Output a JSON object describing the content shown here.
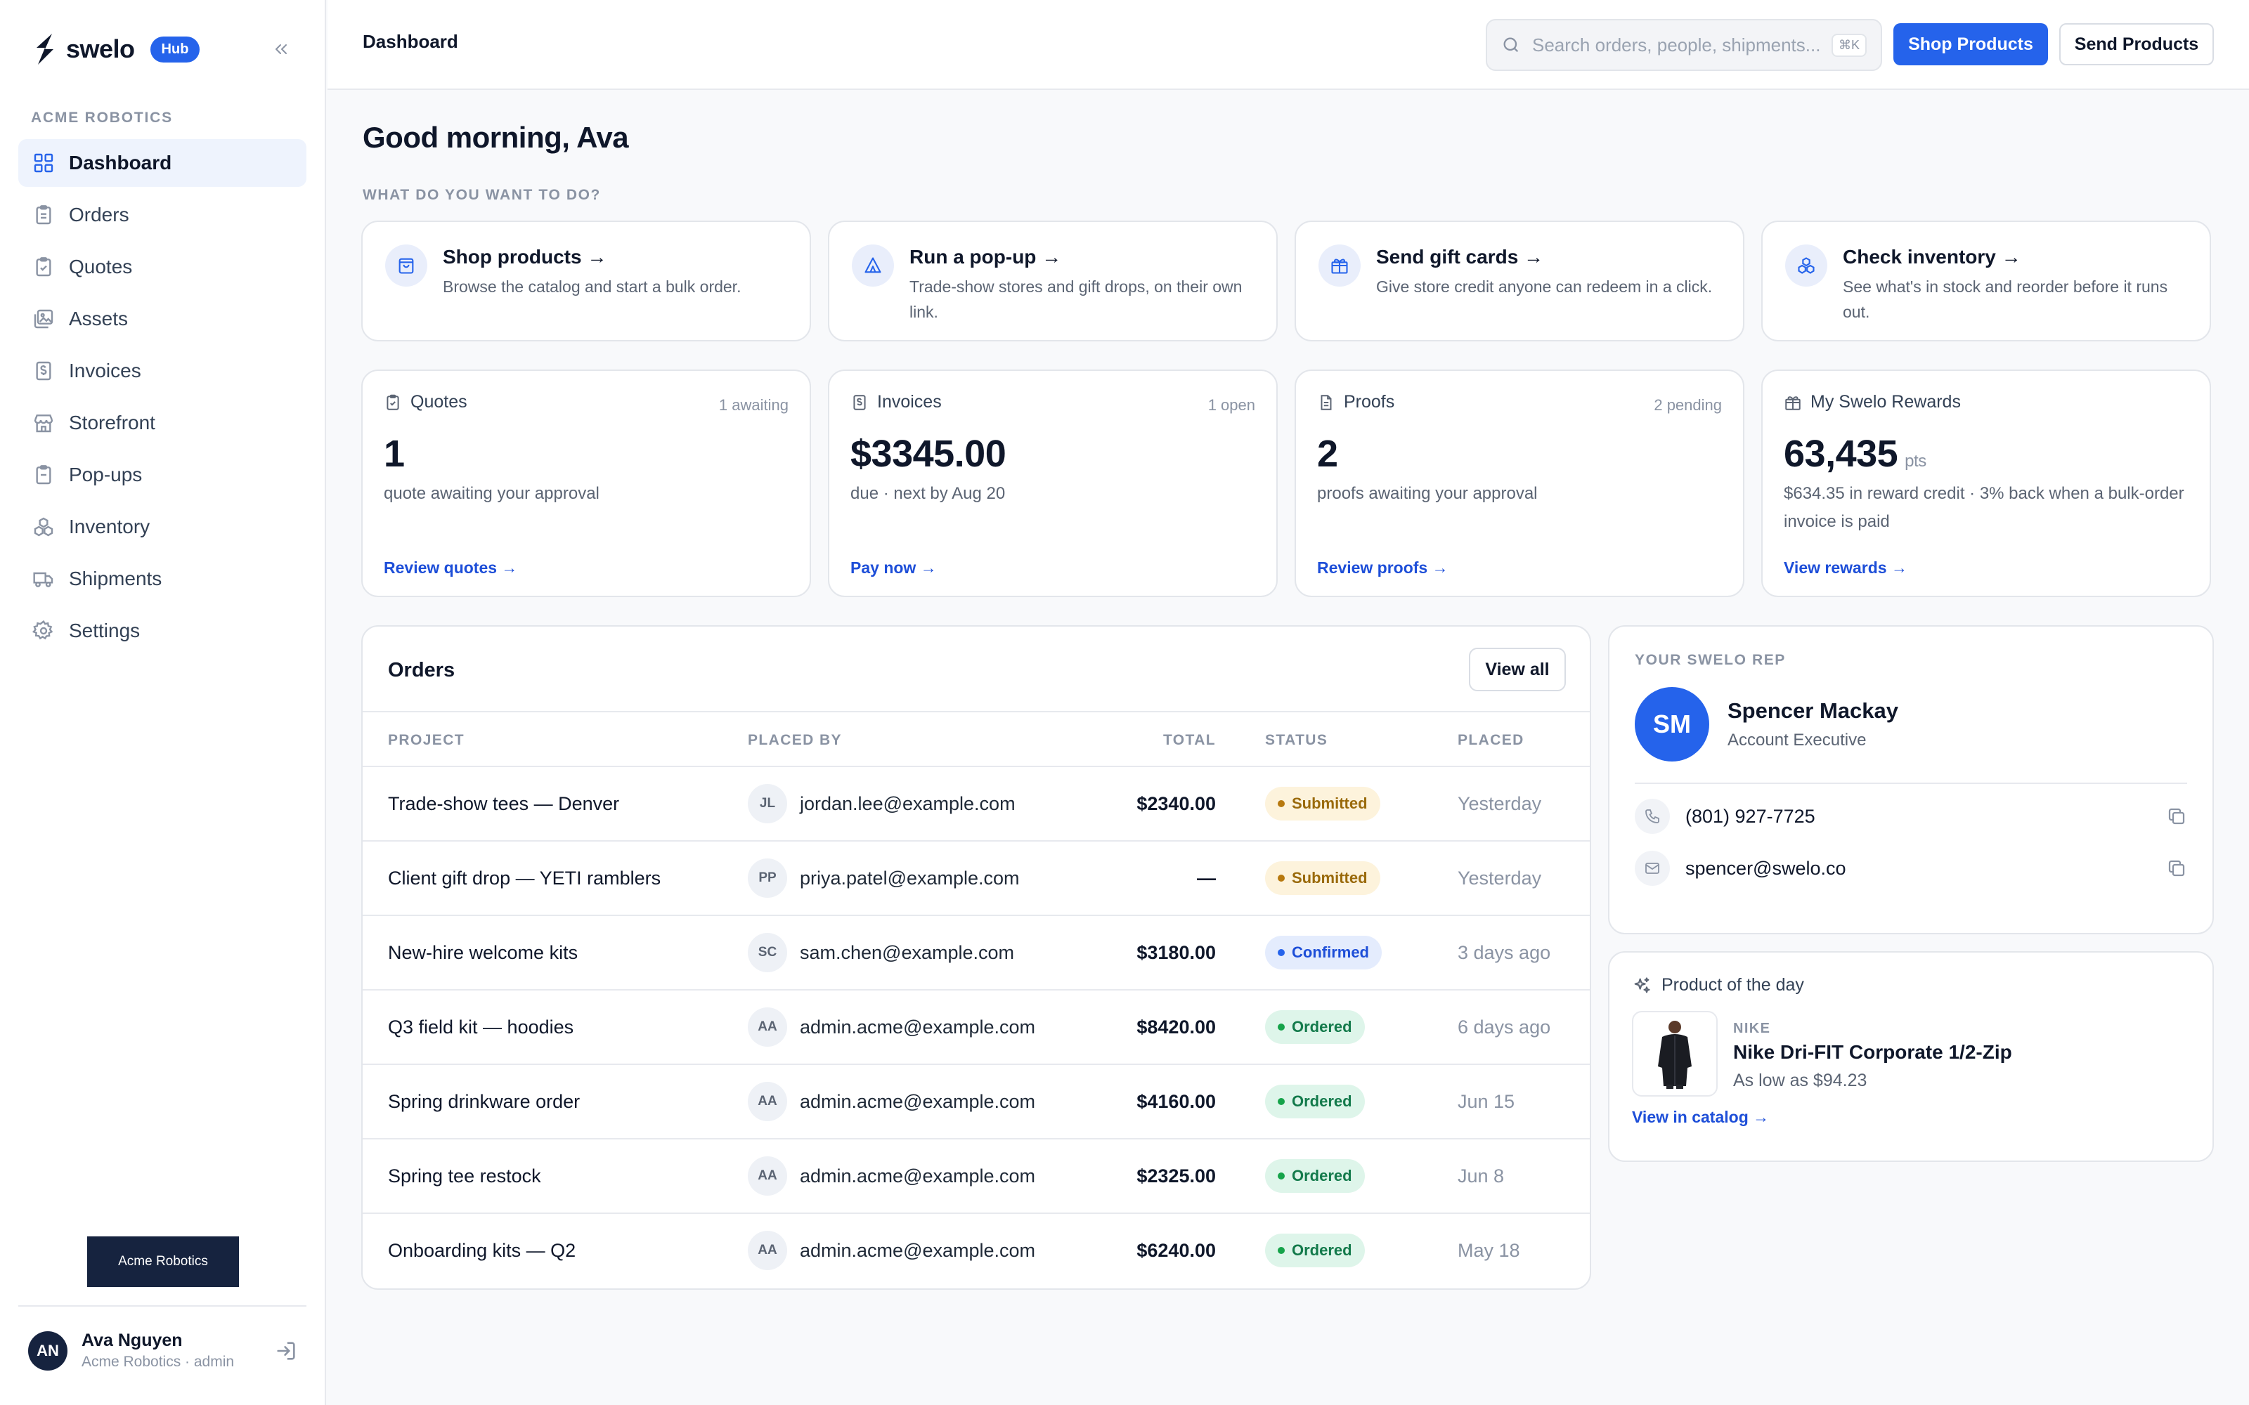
{
  "brand": {
    "name": "swelo",
    "badge": "Hub"
  },
  "sidebar": {
    "org_label": "ACME ROBOTICS",
    "items": [
      {
        "label": "Dashboard",
        "icon": "dashboard-grid-icon",
        "active": true
      },
      {
        "label": "Orders",
        "icon": "clipboard-icon"
      },
      {
        "label": "Quotes",
        "icon": "clipboard-check-icon"
      },
      {
        "label": "Assets",
        "icon": "image-gallery-icon"
      },
      {
        "label": "Invoices",
        "icon": "dollar-document-icon"
      },
      {
        "label": "Storefront",
        "icon": "store-icon"
      },
      {
        "label": "Pop-ups",
        "icon": "clipboard-list-icon"
      },
      {
        "label": "Inventory",
        "icon": "boxes-icon"
      },
      {
        "label": "Shipments",
        "icon": "truck-icon"
      },
      {
        "label": "Settings",
        "icon": "gear-icon"
      }
    ],
    "org_button": "Acme Robotics",
    "user": {
      "initials": "AN",
      "name": "Ava Nguyen",
      "subtitle": "Acme Robotics · admin"
    }
  },
  "header": {
    "crumb": "Dashboard",
    "search": {
      "placeholder": "Search orders, people, shipments...",
      "shortcut": "⌘K"
    },
    "primary_button": "Shop Products",
    "secondary_button": "Send Products"
  },
  "main": {
    "greeting": "Good morning, Ava",
    "actions_label": "WHAT DO YOU WANT TO DO?",
    "actions": [
      {
        "title": "Shop products →",
        "desc": "Browse the catalog and start a bulk order.",
        "icon": "shopping-bag-icon"
      },
      {
        "title": "Run a pop-up →",
        "desc": "Trade-show stores and gift drops, on their own link.",
        "icon": "tent-icon"
      },
      {
        "title": "Send gift cards →",
        "desc": "Give store credit anyone can redeem in a click.",
        "icon": "gift-icon"
      },
      {
        "title": "Check inventory →",
        "desc": "See what's in stock and reorder before it runs out.",
        "icon": "boxes-icon"
      }
    ],
    "stats": [
      {
        "title": "Quotes",
        "side": "1 awaiting",
        "value": "1",
        "unit": "",
        "desc": "quote awaiting your approval",
        "link": "Review quotes →"
      },
      {
        "title": "Invoices",
        "side": "1 open",
        "value": "$3345.00",
        "unit": "",
        "desc": "due · next by Aug 20",
        "link": "Pay now →"
      },
      {
        "title": "Proofs",
        "side": "2 pending",
        "value": "2",
        "unit": "",
        "desc": "proofs awaiting your approval",
        "link": "Review proofs →"
      },
      {
        "title": "My Swelo Rewards",
        "side": "",
        "value": "63,435",
        "unit": "pts",
        "desc": "$634.35 in reward credit · 3% back when a bulk-order invoice is paid",
        "link": "View rewards →"
      }
    ]
  },
  "orders": {
    "title": "Orders",
    "view_all": "View all",
    "columns": {
      "project": "PROJECT",
      "placed_by": "PLACED BY",
      "total": "TOTAL",
      "status": "STATUS",
      "placed": "PLACED"
    },
    "rows": [
      {
        "project": "Trade-show tees — Denver",
        "initials": "JL",
        "email": "jordan.lee@example.com",
        "total": "$2340.00",
        "status": "Submitted",
        "status_kind": "submitted",
        "placed": "Yesterday"
      },
      {
        "project": "Client gift drop — YETI ramblers",
        "initials": "PP",
        "email": "priya.patel@example.com",
        "total": "—",
        "status": "Submitted",
        "status_kind": "submitted",
        "placed": "Yesterday"
      },
      {
        "project": "New-hire welcome kits",
        "initials": "SC",
        "email": "sam.chen@example.com",
        "total": "$3180.00",
        "status": "Confirmed",
        "status_kind": "confirmed",
        "placed": "3 days ago"
      },
      {
        "project": "Q3 field kit — hoodies",
        "initials": "AA",
        "email": "admin.acme@example.com",
        "total": "$8420.00",
        "status": "Ordered",
        "status_kind": "ordered",
        "placed": "6 days ago"
      },
      {
        "project": "Spring drinkware order",
        "initials": "AA",
        "email": "admin.acme@example.com",
        "total": "$4160.00",
        "status": "Ordered",
        "status_kind": "ordered",
        "placed": "Jun 15"
      },
      {
        "project": "Spring tee restock",
        "initials": "AA",
        "email": "admin.acme@example.com",
        "total": "$2325.00",
        "status": "Ordered",
        "status_kind": "ordered",
        "placed": "Jun 8"
      },
      {
        "project": "Onboarding kits — Q2",
        "initials": "AA",
        "email": "admin.acme@example.com",
        "total": "$6240.00",
        "status": "Ordered",
        "status_kind": "ordered",
        "placed": "May 18"
      }
    ]
  },
  "rep": {
    "label": "YOUR SWELO REP",
    "initials": "SM",
    "name": "Spencer Mackay",
    "title": "Account Executive",
    "phone": "(801) 927-7725",
    "email": "spencer@swelo.co"
  },
  "product": {
    "label": "Product of the day",
    "brand": "NIKE",
    "name": "Nike Dri-FIT Corporate 1/2-Zip",
    "price": "As low as $94.23",
    "link": "View in catalog →"
  },
  "colors": {
    "accent": "#2563eb",
    "navy": "#16233f"
  }
}
